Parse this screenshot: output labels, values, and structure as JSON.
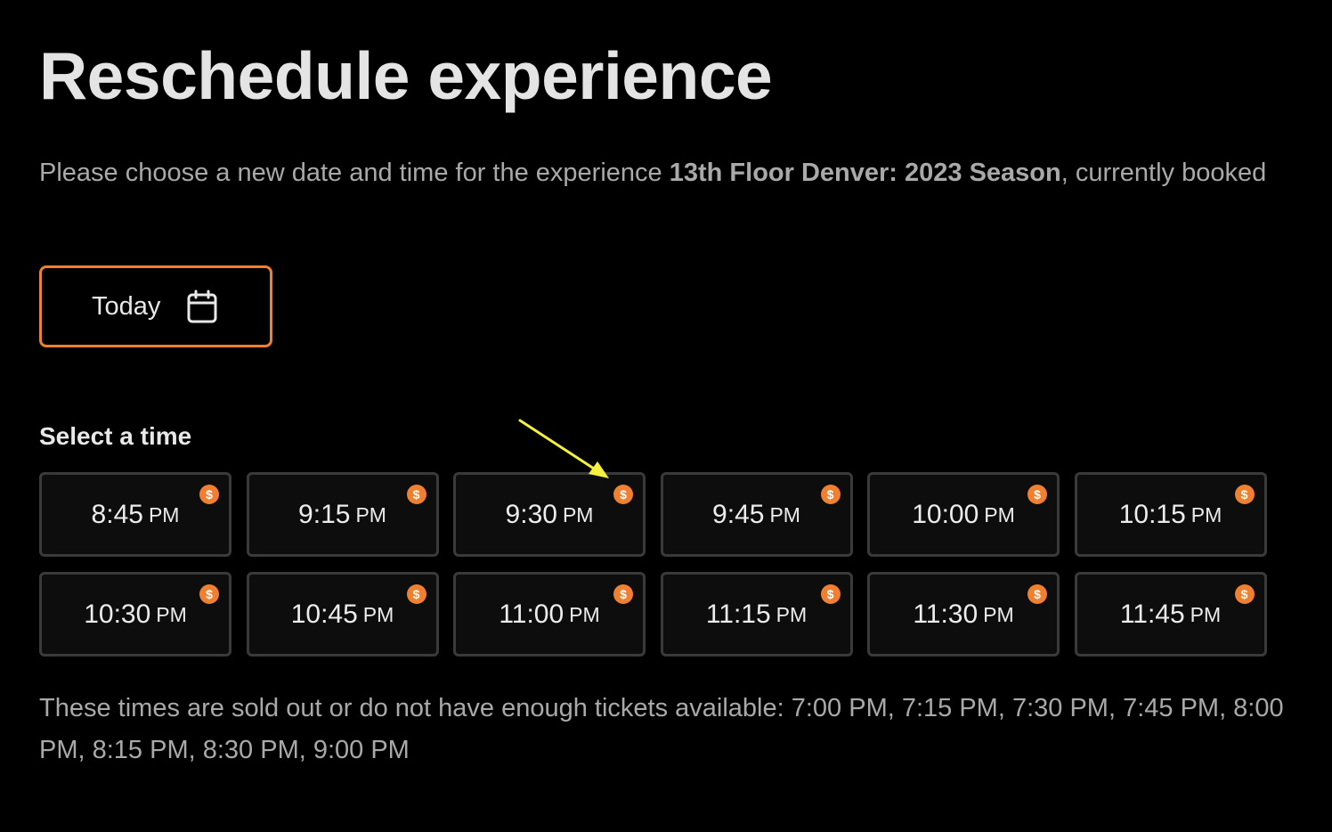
{
  "page": {
    "title": "Reschedule experience",
    "description_prefix": "Please choose a new date and time for the experience ",
    "experience_name": "13th Floor Denver: 2023 Season",
    "description_suffix": ", currently booked"
  },
  "date_picker": {
    "label": "Today",
    "icon": "calendar-icon"
  },
  "time_section": {
    "title": "Select a time",
    "badge_symbol": "$",
    "badge_icon": "dollar-badge-icon",
    "slots": [
      {
        "time": "8:45",
        "ampm": "PM"
      },
      {
        "time": "9:15",
        "ampm": "PM"
      },
      {
        "time": "9:30",
        "ampm": "PM"
      },
      {
        "time": "9:45",
        "ampm": "PM"
      },
      {
        "time": "10:00",
        "ampm": "PM"
      },
      {
        "time": "10:15",
        "ampm": "PM"
      },
      {
        "time": "10:30",
        "ampm": "PM"
      },
      {
        "time": "10:45",
        "ampm": "PM"
      },
      {
        "time": "11:00",
        "ampm": "PM"
      },
      {
        "time": "11:15",
        "ampm": "PM"
      },
      {
        "time": "11:30",
        "ampm": "PM"
      },
      {
        "time": "11:45",
        "ampm": "PM"
      }
    ]
  },
  "sold_out_text": "These times are sold out or do not have enough tickets available: 7:00 PM, 7:15 PM, 7:30 PM, 7:45 PM, 8:00 PM, 8:15 PM, 8:30 PM, 9:00 PM",
  "annotation": {
    "icon": "yellow-arrow-icon",
    "color": "#f5f03c"
  },
  "colors": {
    "accent": "#f07f30",
    "background": "#000000",
    "slot_border": "#3a3a3a",
    "muted_text": "#a9a9a9"
  }
}
